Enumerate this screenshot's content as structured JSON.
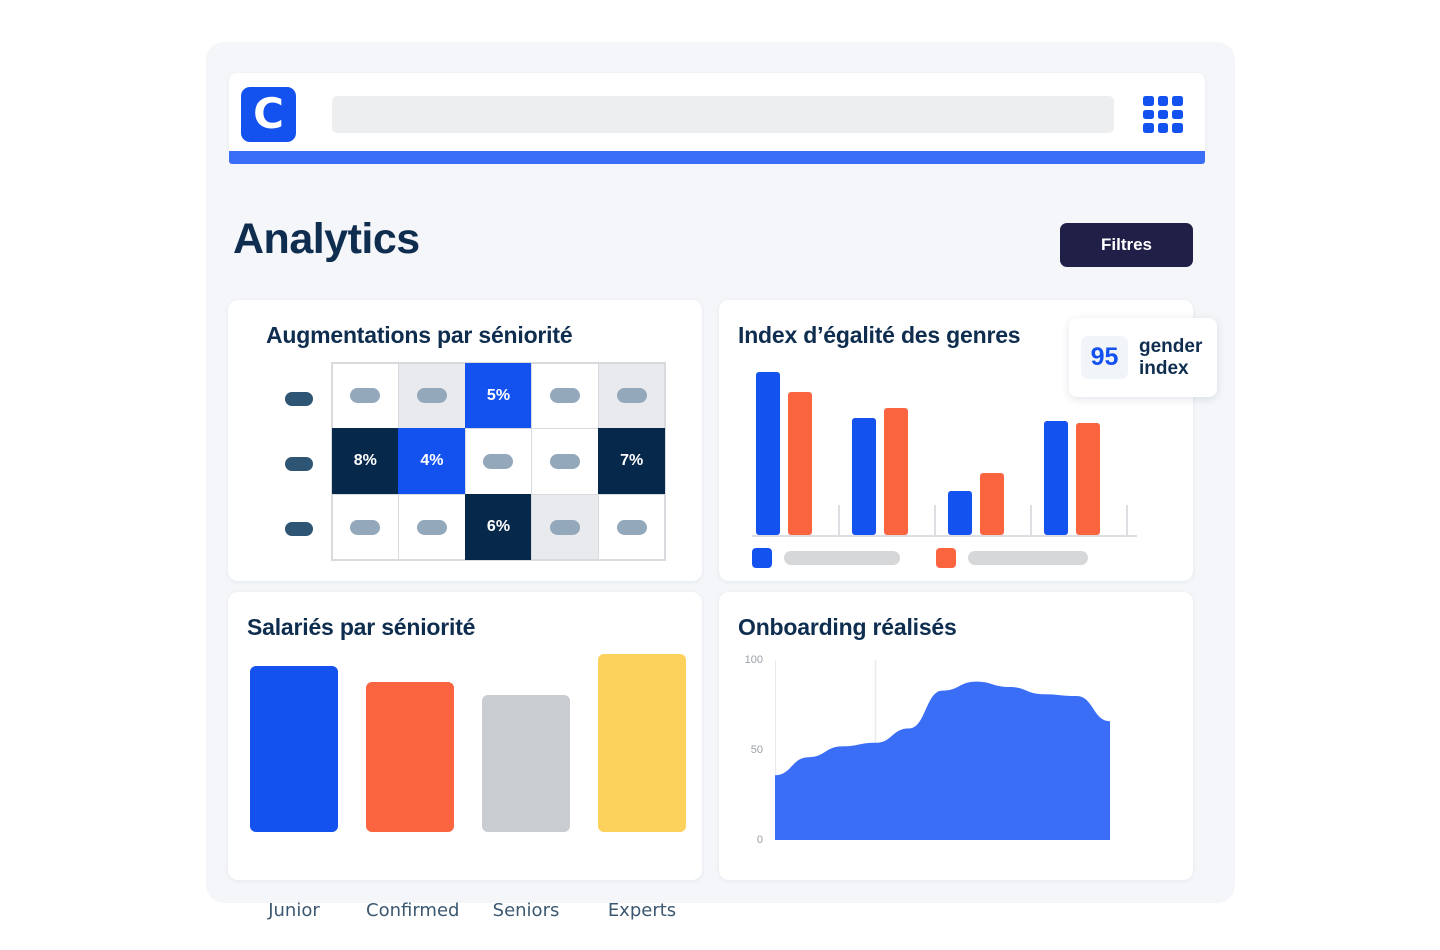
{
  "app": {
    "logo_letter": "C",
    "search_placeholder": "",
    "search_value": "",
    "grid_icon": "grid-apps-icon",
    "accent_color": "#3b6ef6",
    "brand_blue": "#1452f0",
    "navy": "#06284a",
    "orange": "#fa6540",
    "yellow": "#fcd25c",
    "gray": "#c9ccd1"
  },
  "header": {
    "title": "Analytics",
    "filter_button": "Filtres"
  },
  "cards": {
    "heatmap": {
      "title": "Augmentations par séniorité"
    },
    "gender": {
      "title": "Index d’égalité des genres"
    },
    "salary": {
      "title": "Salariés par séniorité"
    },
    "onboarding": {
      "title": "Onboarding réalisés"
    }
  },
  "gender_badge": {
    "score": "95",
    "label_line1": "gender",
    "label_line2": "index"
  },
  "chart_data": [
    {
      "id": "heatmap",
      "type": "heatmap",
      "title": "Augmentations par séniorité",
      "rows": 3,
      "cols": 5,
      "row_labels": [
        "",
        "",
        ""
      ],
      "cells": [
        [
          {
            "value": "",
            "state": "white"
          },
          {
            "value": "",
            "state": "gray"
          },
          {
            "value": "5%",
            "state": "blue"
          },
          {
            "value": "",
            "state": "white"
          },
          {
            "value": "",
            "state": "gray"
          }
        ],
        [
          {
            "value": "8%",
            "state": "navy"
          },
          {
            "value": "4%",
            "state": "blue"
          },
          {
            "value": "",
            "state": "white"
          },
          {
            "value": "",
            "state": "white"
          },
          {
            "value": "7%",
            "state": "navy"
          }
        ],
        [
          {
            "value": "",
            "state": "white"
          },
          {
            "value": "",
            "state": "white"
          },
          {
            "value": "6%",
            "state": "navy"
          },
          {
            "value": "",
            "state": "gray"
          },
          {
            "value": "",
            "state": "white"
          }
        ]
      ]
    },
    {
      "id": "gender",
      "type": "bar",
      "title": "Index d’égalité des genres",
      "categories": [
        "",
        "",
        "",
        ""
      ],
      "series": [
        {
          "name": "",
          "color": "#1452f0",
          "values": [
            100,
            72,
            27,
            70
          ]
        },
        {
          "name": "",
          "color": "#fa6540",
          "values": [
            88,
            78,
            38,
            69
          ]
        }
      ],
      "ylim": [
        0,
        100
      ],
      "grid": false,
      "legend": "bottom-left",
      "legend_entries": [
        {
          "color": "#1452f0",
          "label": ""
        },
        {
          "color": "#fa6540",
          "label": ""
        }
      ]
    },
    {
      "id": "salary",
      "type": "bar",
      "title": "Salariés par séniorité",
      "categories": [
        "Junior",
        "Confirmed",
        "Seniors",
        "Experts"
      ],
      "values": [
        93,
        84,
        77,
        100
      ],
      "colors": [
        "#1452f0",
        "#fa6540",
        "#c9ccd1",
        "#fcd25c"
      ],
      "xlabel": "",
      "ylabel": "",
      "ylim": [
        0,
        100
      ],
      "grid": false
    },
    {
      "id": "onboarding",
      "type": "area",
      "title": "Onboarding réalisés",
      "ylabel": "",
      "xlabel": "",
      "ylim": [
        0,
        100
      ],
      "ytick_labels": [
        "100",
        "50",
        "0"
      ],
      "ytick_values": [
        100,
        50,
        0
      ],
      "grid": false,
      "color": "#3b6ef6",
      "x": [
        0,
        1,
        2,
        3,
        4,
        5,
        6,
        7,
        8,
        9,
        10
      ],
      "y": [
        36,
        46,
        52,
        54,
        62,
        83,
        88,
        85,
        81,
        80,
        66
      ]
    }
  ]
}
